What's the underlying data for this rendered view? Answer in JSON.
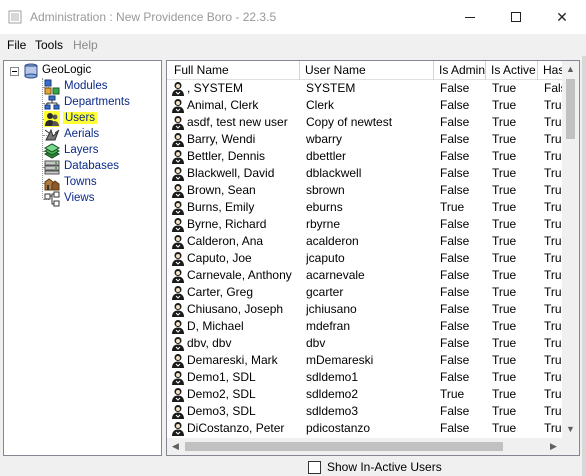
{
  "window": {
    "title": "Administration : New Providence Boro - 22.3.5",
    "minimize_glyph": "",
    "maximize_glyph": "",
    "close_glyph": "✕"
  },
  "menu": {
    "file": "File",
    "tools": "Tools",
    "help": "Help"
  },
  "tree": {
    "root": "GeoLogic",
    "items": [
      {
        "label": "Modules",
        "icon": "modules-icon"
      },
      {
        "label": "Departments",
        "icon": "departments-icon"
      },
      {
        "label": "Users",
        "icon": "users-icon",
        "selected": true
      },
      {
        "label": "Aerials",
        "icon": "aerials-icon"
      },
      {
        "label": "Layers",
        "icon": "layers-icon"
      },
      {
        "label": "Databases",
        "icon": "databases-icon"
      },
      {
        "label": "Towns",
        "icon": "towns-icon"
      },
      {
        "label": "Views",
        "icon": "views-icon"
      }
    ]
  },
  "grid": {
    "columns": [
      "Full Name",
      "User Name",
      "Is Admin",
      "Is Active",
      "Has"
    ],
    "rows": [
      [
        ", SYSTEM",
        "SYSTEM",
        "False",
        "True",
        "Fals"
      ],
      [
        "Animal, Clerk",
        "Clerk",
        "False",
        "True",
        "True"
      ],
      [
        "asdf, test new user",
        "Copy of newtest",
        "False",
        "True",
        "True"
      ],
      [
        "Barry, Wendi",
        "wbarry",
        "False",
        "True",
        "True"
      ],
      [
        "Bettler, Dennis",
        "dbettler",
        "False",
        "True",
        "True"
      ],
      [
        "Blackwell, David",
        "dblackwell",
        "False",
        "True",
        "True"
      ],
      [
        "Brown, Sean",
        "sbrown",
        "False",
        "True",
        "True"
      ],
      [
        "Burns, Emily",
        "eburns",
        "True",
        "True",
        "True"
      ],
      [
        "Byrne, Richard",
        "rbyrne",
        "False",
        "True",
        "True"
      ],
      [
        "Calderon, Ana",
        "acalderon",
        "False",
        "True",
        "True"
      ],
      [
        "Caputo, Joe",
        "jcaputo",
        "False",
        "True",
        "True"
      ],
      [
        "Carnevale, Anthony",
        "acarnevale",
        "False",
        "True",
        "True"
      ],
      [
        "Carter, Greg",
        "gcarter",
        "False",
        "True",
        "True"
      ],
      [
        "Chiusano, Joseph",
        "jchiusano",
        "False",
        "True",
        "True"
      ],
      [
        "D, Michael",
        "mdefran",
        "False",
        "True",
        "True"
      ],
      [
        "dbv, dbv",
        "dbv",
        "False",
        "True",
        "True"
      ],
      [
        "Demareski, Mark",
        "mDemareski",
        "False",
        "True",
        "True"
      ],
      [
        "Demo1, SDL",
        "sdldemo1",
        "False",
        "True",
        "True"
      ],
      [
        "Demo2, SDL",
        "sdldemo2",
        "True",
        "True",
        "True"
      ],
      [
        "Demo3, SDL",
        "sdldemo3",
        "False",
        "True",
        "True"
      ],
      [
        "DiCostanzo, Peter",
        "pdicostanzo",
        "False",
        "True",
        "True"
      ]
    ]
  },
  "footer": {
    "show_inactive_label": "Show In-Active Users",
    "show_inactive_checked": false
  }
}
